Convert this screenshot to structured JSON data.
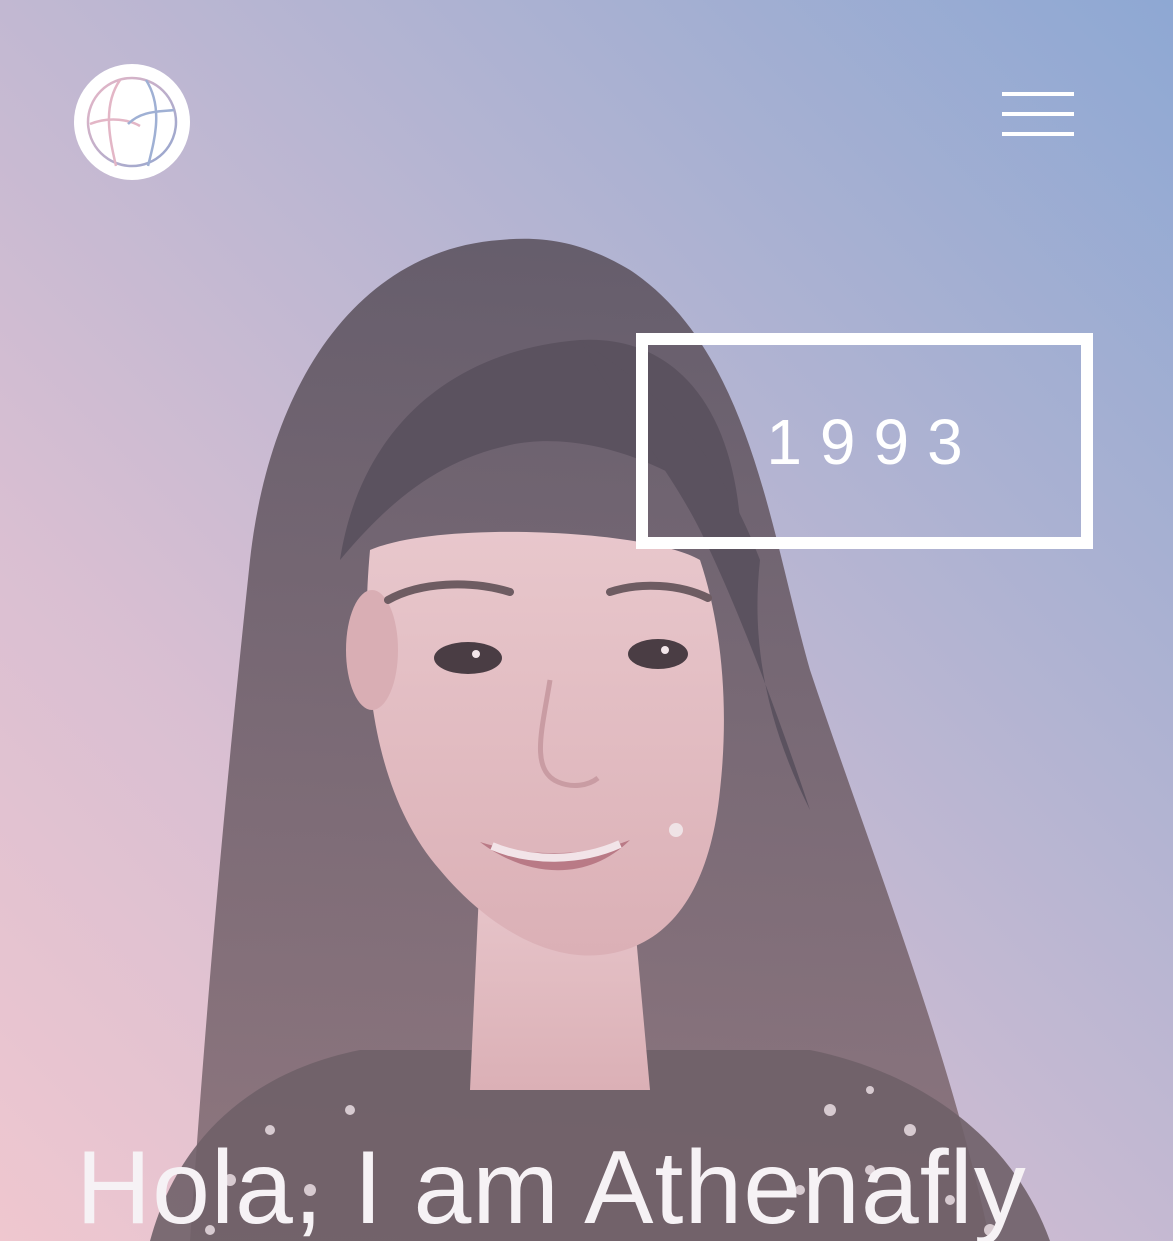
{
  "header": {
    "logo_icon": "monogram-logo-icon",
    "menu_icon": "hamburger-menu-icon"
  },
  "hero": {
    "year": "1993",
    "headline": "Hola, I am Athenafly",
    "portrait": "portrait-photo"
  },
  "colors": {
    "gradient_top_right": "#8ea8d3",
    "gradient_bottom_left": "#efc7cf",
    "foreground": "#ffffff"
  }
}
